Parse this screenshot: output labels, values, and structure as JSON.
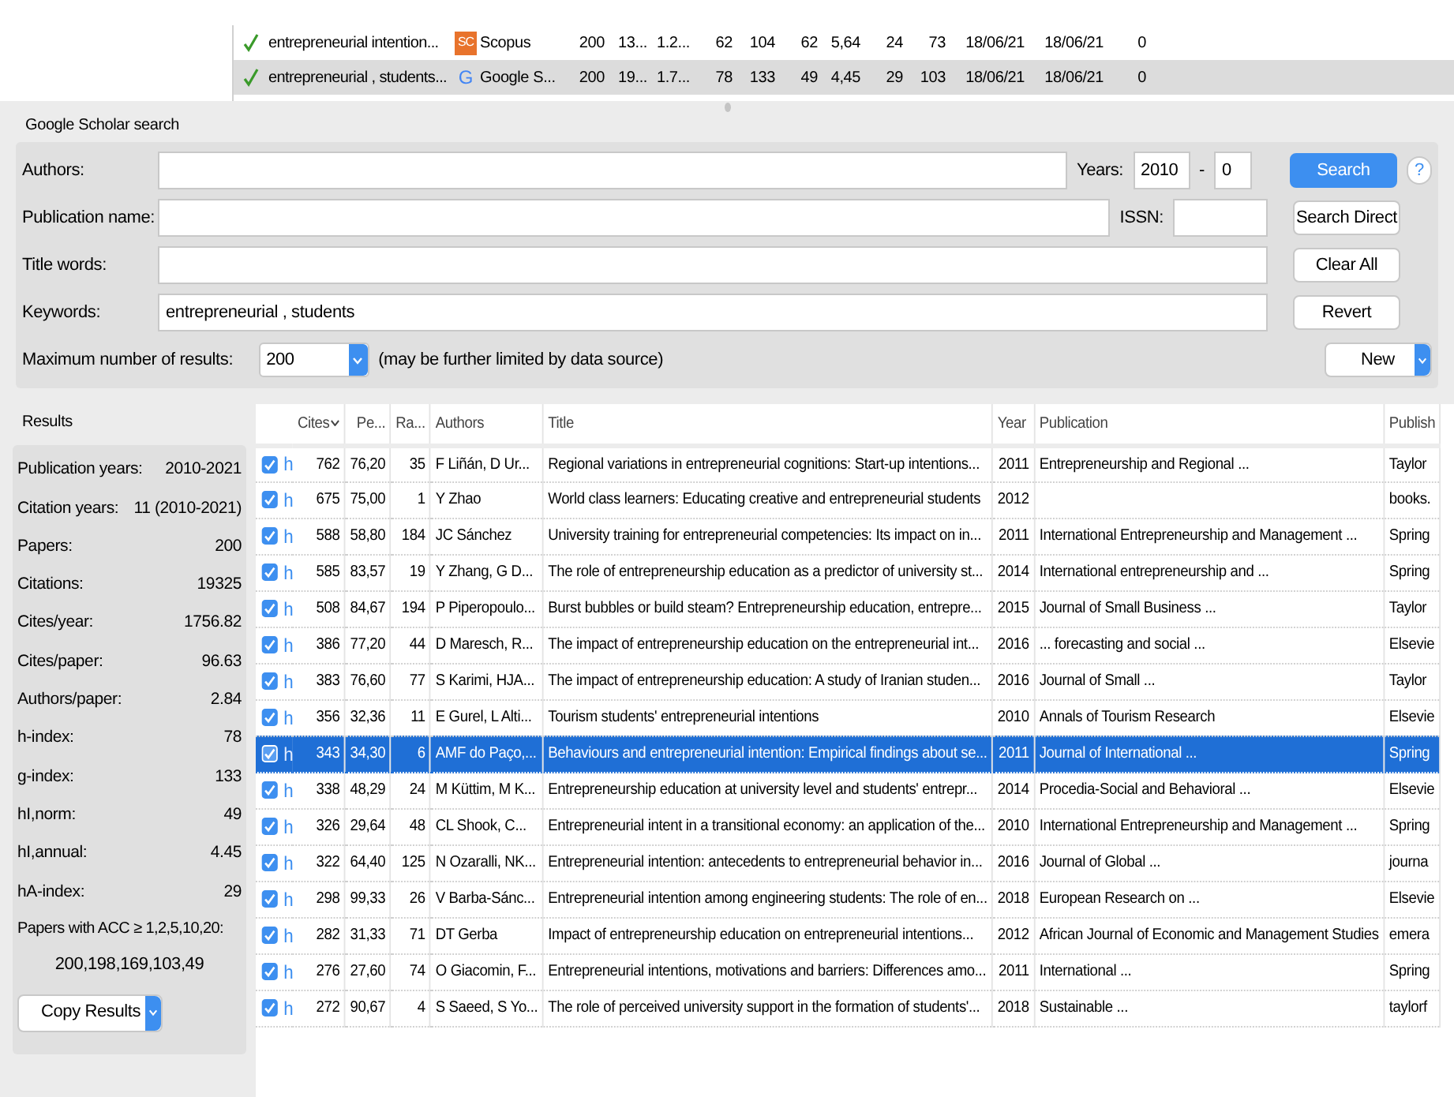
{
  "queries": [
    {
      "checked": true,
      "selected": false,
      "query": "entrepreneurial intention...",
      "kind": "badge",
      "source_icon": "SC",
      "source": "Scopus",
      "values": [
        "200",
        "13...",
        "1.2...",
        "62",
        "104",
        "62",
        "5,64",
        "24",
        "73",
        "18/06/21",
        "18/06/21",
        "0"
      ]
    },
    {
      "checked": true,
      "selected": true,
      "query": "entrepreneurial , students...",
      "kind": "letter",
      "source_icon": "G",
      "source": "Google S...",
      "values": [
        "200",
        "19...",
        "1.7...",
        "78",
        "133",
        "49",
        "4,45",
        "29",
        "103",
        "18/06/21",
        "18/06/21",
        "0"
      ]
    }
  ],
  "search": {
    "title": "Google Scholar search",
    "authors": {
      "label": "Authors:"
    },
    "years": {
      "label": "Years:",
      "from": "2010",
      "dash": "-",
      "to": "0"
    },
    "search_button": "Search",
    "help": "?",
    "publication": {
      "label": "Publication name:"
    },
    "issn": {
      "label": "ISSN:"
    },
    "search_direct_button": "Search Direct",
    "title_words": {
      "label": "Title words:"
    },
    "clear_all_button": "Clear All",
    "keywords": {
      "label": "Keywords:",
      "value": "entrepreneurial , students"
    },
    "revert_button": "Revert",
    "max_results": {
      "label": "Maximum number of results:",
      "value": "200",
      "note": "(may be further limited by data source)"
    },
    "new_button": "New"
  },
  "results": {
    "title": "Results",
    "stats": [
      {
        "label": "Publication years:",
        "value": "2010-2021"
      },
      {
        "label": "Citation years:",
        "value": "11 (2010-2021)"
      },
      {
        "label": "Papers:",
        "value": "200"
      },
      {
        "label": "Citations:",
        "value": "19325"
      },
      {
        "label": "Cites/year:",
        "value": "1756.82"
      },
      {
        "label": "Cites/paper:",
        "value": "96.63"
      },
      {
        "label": "Authors/paper:",
        "value": "2.84"
      },
      {
        "label": "h-index:",
        "value": "78"
      },
      {
        "label": "g-index:",
        "value": "133"
      },
      {
        "label": "hI,norm:",
        "value": "49"
      },
      {
        "label": "hI,annual:",
        "value": "4.45"
      },
      {
        "label": "hA-index:",
        "value": "29"
      }
    ],
    "acc": {
      "label": "Papers with ACC ≥ 1,2,5,10,20:",
      "value": "200,198,169,103,49"
    },
    "copy_button": "Copy Results"
  },
  "table": {
    "columns": [
      {
        "label": "Cites",
        "sorted": true
      },
      {
        "label": "Pe...",
        "sorted": false
      },
      {
        "label": "Ra...",
        "sorted": false
      },
      {
        "label": "Authors",
        "sorted": false
      },
      {
        "label": "Title",
        "sorted": false
      },
      {
        "label": "Year",
        "sorted": false
      },
      {
        "label": "Publication",
        "sorted": false
      },
      {
        "label": "Publish",
        "sorted": false
      }
    ],
    "rows": [
      {
        "checked": true,
        "selected": false,
        "mark": "h",
        "cites": "762",
        "per_year": "76,20",
        "rank": "35",
        "authors": "F Liñán, D Ur...",
        "title": "Regional variations in entrepreneurial cognitions: Start-up intentions...",
        "year": "2011",
        "publication": "Entrepreneurship and Regional ...",
        "publisher": "Taylor"
      },
      {
        "checked": true,
        "selected": false,
        "mark": "h",
        "cites": "675",
        "per_year": "75,00",
        "rank": "1",
        "authors": "Y Zhao",
        "title": "World class learners: Educating creative and entrepreneurial students",
        "year": "2012",
        "publication": "",
        "publisher": "books."
      },
      {
        "checked": true,
        "selected": false,
        "mark": "h",
        "cites": "588",
        "per_year": "58,80",
        "rank": "184",
        "authors": "JC Sánchez",
        "title": "University training for entrepreneurial competencies: Its impact on in...",
        "year": "2011",
        "publication": "International Entrepreneurship and Management ...",
        "publisher": "Spring"
      },
      {
        "checked": true,
        "selected": false,
        "mark": "h",
        "cites": "585",
        "per_year": "83,57",
        "rank": "19",
        "authors": "Y Zhang, G D...",
        "title": "The role of entrepreneurship education as a predictor of university st...",
        "year": "2014",
        "publication": "International entrepreneurship and ...",
        "publisher": "Spring"
      },
      {
        "checked": true,
        "selected": false,
        "mark": "h",
        "cites": "508",
        "per_year": "84,67",
        "rank": "194",
        "authors": "P Piperopoulo...",
        "title": "Burst bubbles or build steam? Entrepreneurship education, entrepre...",
        "year": "2015",
        "publication": "Journal of Small Business ...",
        "publisher": "Taylor"
      },
      {
        "checked": true,
        "selected": false,
        "mark": "h",
        "cites": "386",
        "per_year": "77,20",
        "rank": "44",
        "authors": "D Maresch, R...",
        "title": "The impact of entrepreneurship education on the entrepreneurial int...",
        "year": "2016",
        "publication": "... forecasting and social ...",
        "publisher": "Elsevie"
      },
      {
        "checked": true,
        "selected": false,
        "mark": "h",
        "cites": "383",
        "per_year": "76,60",
        "rank": "77",
        "authors": "S Karimi, HJA...",
        "title": "The impact of entrepreneurship education: A study of Iranian studen...",
        "year": "2016",
        "publication": "Journal of Small ...",
        "publisher": "Taylor"
      },
      {
        "checked": true,
        "selected": false,
        "mark": "h",
        "cites": "356",
        "per_year": "32,36",
        "rank": "11",
        "authors": "E Gurel, L Alti...",
        "title": "Tourism students' entrepreneurial intentions",
        "year": "2010",
        "publication": "Annals of Tourism Research",
        "publisher": "Elsevie"
      },
      {
        "checked": true,
        "selected": true,
        "mark": "h",
        "cites": "343",
        "per_year": "34,30",
        "rank": "6",
        "authors": "AMF do Paço,...",
        "title": "Behaviours and entrepreneurial intention: Empirical findings about se...",
        "year": "2011",
        "publication": "Journal of International ...",
        "publisher": "Spring"
      },
      {
        "checked": true,
        "selected": false,
        "mark": "h",
        "cites": "338",
        "per_year": "48,29",
        "rank": "24",
        "authors": "M Küttim, M K...",
        "title": "Entrepreneurship education at university level and students' entrepr...",
        "year": "2014",
        "publication": "Procedia-Social and Behavioral ...",
        "publisher": "Elsevie"
      },
      {
        "checked": true,
        "selected": false,
        "mark": "h",
        "cites": "326",
        "per_year": "29,64",
        "rank": "48",
        "authors": "CL Shook, C...",
        "title": "Entrepreneurial intent in a transitional economy: an application of the...",
        "year": "2010",
        "publication": "International Entrepreneurship and Management ...",
        "publisher": "Spring"
      },
      {
        "checked": true,
        "selected": false,
        "mark": "h",
        "cites": "322",
        "per_year": "64,40",
        "rank": "125",
        "authors": "N Ozaralli, NK...",
        "title": "Entrepreneurial intention: antecedents to entrepreneurial behavior in...",
        "year": "2016",
        "publication": "Journal of Global ...",
        "publisher": "journa"
      },
      {
        "checked": true,
        "selected": false,
        "mark": "h",
        "cites": "298",
        "per_year": "99,33",
        "rank": "26",
        "authors": "V Barba-Sánc...",
        "title": "Entrepreneurial intention among engineering students: The role of en...",
        "year": "2018",
        "publication": "European Research on ...",
        "publisher": "Elsevie"
      },
      {
        "checked": true,
        "selected": false,
        "mark": "h",
        "cites": "282",
        "per_year": "31,33",
        "rank": "71",
        "authors": "DT Gerba",
        "title": "Impact of entrepreneurship education on entrepreneurial intentions...",
        "year": "2012",
        "publication": "African Journal of Economic and Management Studies",
        "publisher": "emera"
      },
      {
        "checked": true,
        "selected": false,
        "mark": "h",
        "cites": "276",
        "per_year": "27,60",
        "rank": "74",
        "authors": "O Giacomin, F...",
        "title": "Entrepreneurial intentions, motivations and barriers: Differences amo...",
        "year": "2011",
        "publication": "International ...",
        "publisher": "Spring"
      },
      {
        "checked": true,
        "selected": false,
        "mark": "h",
        "cites": "272",
        "per_year": "90,67",
        "rank": "4",
        "authors": "S Saeed, S Yo...",
        "title": "The role of perceived university support in the formation of students'...",
        "year": "2018",
        "publication": "Sustainable ...",
        "publisher": "taylorf"
      }
    ]
  }
}
